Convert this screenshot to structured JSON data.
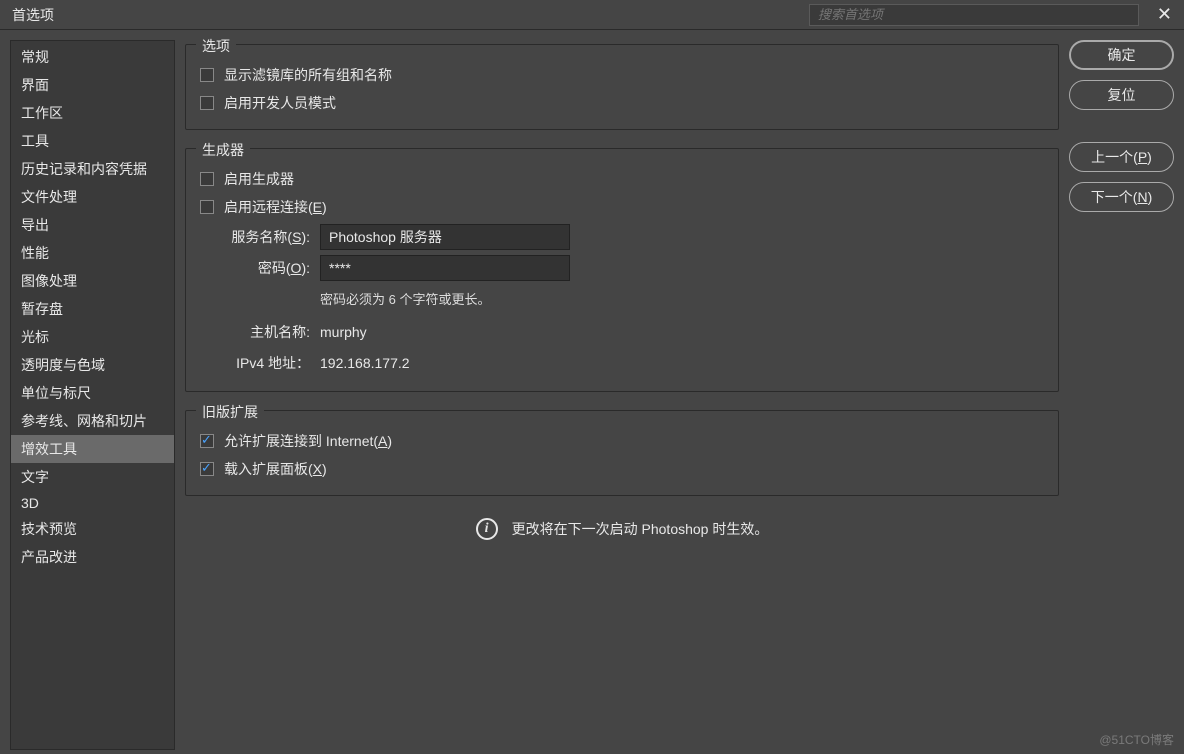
{
  "titlebar": {
    "title": "首选项",
    "search_placeholder": "搜索首选项"
  },
  "sidebar": {
    "items": [
      "常规",
      "界面",
      "工作区",
      "工具",
      "历史记录和内容凭据",
      "文件处理",
      "导出",
      "性能",
      "图像处理",
      "暂存盘",
      "光标",
      "透明度与色域",
      "单位与标尺",
      "参考线、网格和切片",
      "增效工具",
      "文字",
      "3D",
      "技术预览",
      "产品改进"
    ],
    "active_index": 14
  },
  "groups": {
    "options": {
      "title": "选项",
      "cb1": "显示滤镜库的所有组和名称",
      "cb2": "启用开发人员模式"
    },
    "generator": {
      "title": "生成器",
      "cb1": "启用生成器",
      "cb2_prefix": "启用远程连接(",
      "cb2_hotkey": "E",
      "cb2_suffix": ")",
      "service_label_prefix": "服务名称(",
      "service_hotkey": "S",
      "service_label_suffix": "):",
      "service_value": "Photoshop 服务器",
      "password_label_prefix": "密码(",
      "password_hotkey": "O",
      "password_label_suffix": "):",
      "password_value": "****",
      "password_hint": "密码必须为 6 个字符或更长。",
      "hostname_label": "主机名称:",
      "hostname_value": "murphy",
      "ipv4_label": "IPv4 地址：",
      "ipv4_value": "192.168.177.2"
    },
    "legacy": {
      "title": "旧版扩展",
      "cb1_prefix": "允许扩展连接到 Internet(",
      "cb1_hotkey": "A",
      "cb1_suffix": ")",
      "cb2_prefix": "载入扩展面板(",
      "cb2_hotkey": "X",
      "cb2_suffix": ")"
    }
  },
  "info": "更改将在下一次启动 Photoshop 时生效。",
  "buttons": {
    "ok": "确定",
    "reset": "复位",
    "prev_prefix": "上一个(",
    "prev_hotkey": "P",
    "prev_suffix": ")",
    "next_prefix": "下一个(",
    "next_hotkey": "N",
    "next_suffix": ")"
  },
  "watermark": "@51CTO博客"
}
